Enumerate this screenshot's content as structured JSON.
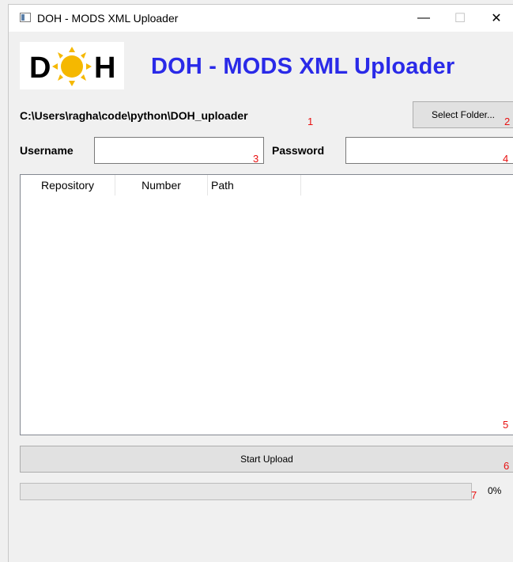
{
  "window": {
    "title": "DOH - MODS XML Uploader",
    "controls": {
      "minimize": "—",
      "maximize": "☐",
      "close": "✕"
    }
  },
  "header": {
    "logo_text_left": "D",
    "logo_text_right": "H",
    "title": "DOH - MODS XML Uploader",
    "title_color": "#2a2ae8"
  },
  "folder": {
    "path": "C:\\Users\\ragha\\code\\python\\DOH_uploader",
    "select_button_label": "Select Folder..."
  },
  "credentials": {
    "username_label": "Username",
    "username_value": "",
    "password_label": "Password",
    "password_value": ""
  },
  "table": {
    "columns": [
      "Repository",
      "Number",
      "Path"
    ],
    "rows": []
  },
  "actions": {
    "start_upload_label": "Start Upload"
  },
  "progress": {
    "value": 0,
    "text": "0%"
  },
  "annotations": [
    "1",
    "2",
    "3",
    "4",
    "5",
    "6",
    "7"
  ],
  "colors": {
    "annotation": "#e81010",
    "sun": "#f5b800",
    "progress_fill": "#06b025"
  }
}
